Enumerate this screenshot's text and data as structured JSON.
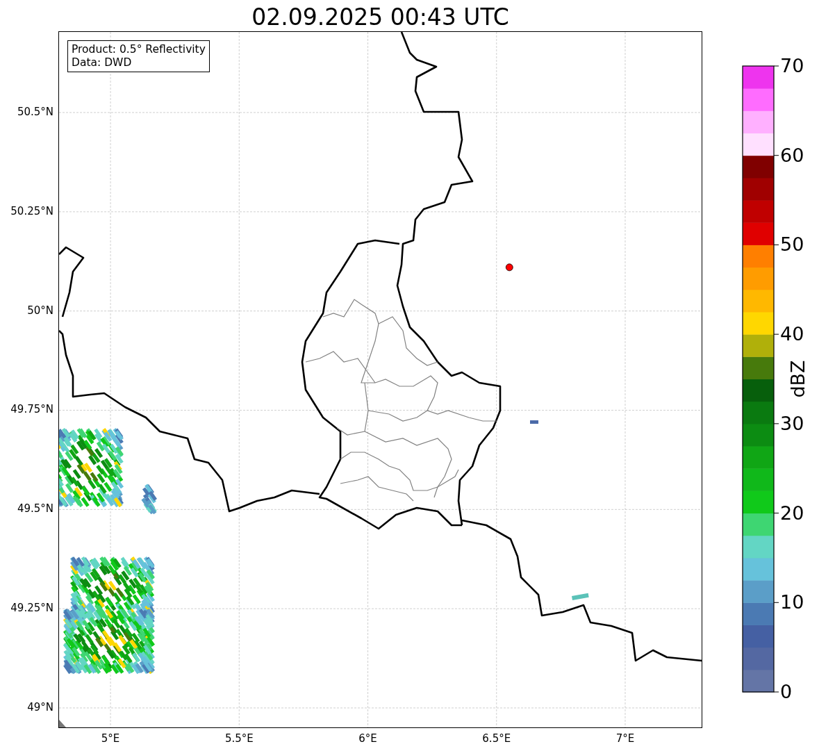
{
  "title": "02.09.2025 00:43 UTC",
  "map": {
    "legend": [
      "Product: 0.5° Reflectivity",
      "Data: DWD"
    ],
    "xticks": [
      "5°E",
      "5.5°E",
      "6°E",
      "6.5°E",
      "7°E"
    ],
    "yticks": [
      "50.5°N",
      "50.25°N",
      "50°N",
      "49.75°N",
      "49.5°N",
      "49.25°N",
      "49°N"
    ]
  },
  "colorbar": {
    "label": "dBZ",
    "ticks": [
      "70",
      "60",
      "50",
      "40",
      "30",
      "20",
      "10",
      "0"
    ],
    "bins": [
      {
        "color": "#6475a6"
      },
      {
        "color": "#5468a2"
      },
      {
        "color": "#4560a3"
      },
      {
        "color": "#4b7ab3"
      },
      {
        "color": "#5b9ec8"
      },
      {
        "color": "#66c2db"
      },
      {
        "color": "#63d6c4"
      },
      {
        "color": "#3ed672"
      },
      {
        "color": "#10c91a"
      },
      {
        "color": "#10b81a"
      },
      {
        "color": "#10a615"
      },
      {
        "color": "#0c8c12"
      },
      {
        "color": "#0a7a10"
      },
      {
        "color": "#075f0c"
      },
      {
        "color": "#477a0c"
      },
      {
        "color": "#b0b00a"
      },
      {
        "color": "#ffd700"
      },
      {
        "color": "#ffb800"
      },
      {
        "color": "#ff9c00"
      },
      {
        "color": "#ff7f00"
      },
      {
        "color": "#e00000"
      },
      {
        "color": "#c00000"
      },
      {
        "color": "#a00000"
      },
      {
        "color": "#800000"
      },
      {
        "color": "#ffe0ff"
      },
      {
        "color": "#ffb0ff"
      },
      {
        "color": "#ff6cff"
      },
      {
        "color": "#ee34ee"
      }
    ]
  }
}
